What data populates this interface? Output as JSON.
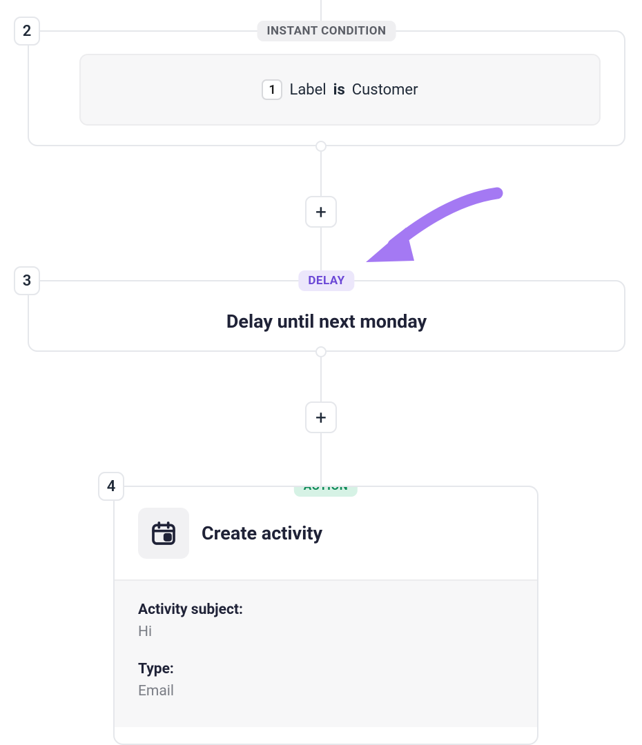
{
  "steps": {
    "s2": {
      "number": "2",
      "pill": "INSTANT CONDITION",
      "cond_index": "1",
      "cond_field": "Label",
      "cond_op": "is",
      "cond_value": "Customer"
    },
    "s3": {
      "number": "3",
      "pill": "DELAY",
      "title": "Delay until next monday"
    },
    "s4": {
      "number": "4",
      "pill": "ACTION",
      "title": "Create activity",
      "field1_label": "Activity subject:",
      "field1_value": "Hi",
      "field2_label": "Type:",
      "field2_value": "Email"
    }
  },
  "icons": {
    "plus": "+"
  },
  "colors": {
    "purple": "#9b6df5"
  }
}
